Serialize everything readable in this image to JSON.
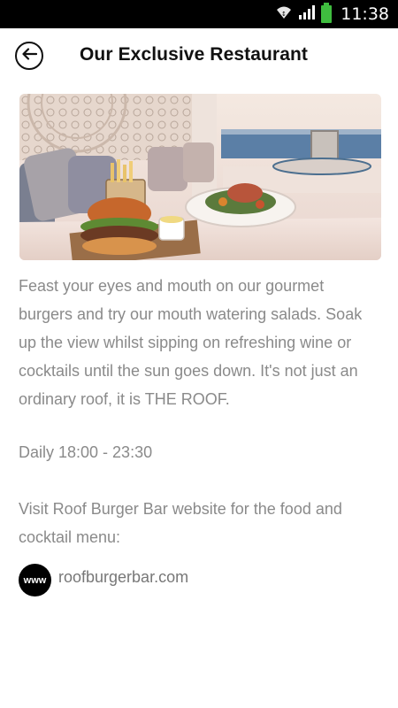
{
  "status_bar": {
    "time": "11:38"
  },
  "header": {
    "title": "Our Exclusive Restaurant"
  },
  "content": {
    "description": "Feast your eyes and mouth on our gourmet burgers and try our mouth watering salads. Soak up the view whilst sipping on refreshing wine or cocktails until the sun goes down. It's not just an ordinary roof, it is THE ROOF.",
    "hours": "Daily 18:00 - 23:30",
    "visit_text": "Visit Roof Burger Bar website for the food and cocktail menu:",
    "website_icon_label": "www",
    "website": "roofburgerbar.com"
  }
}
